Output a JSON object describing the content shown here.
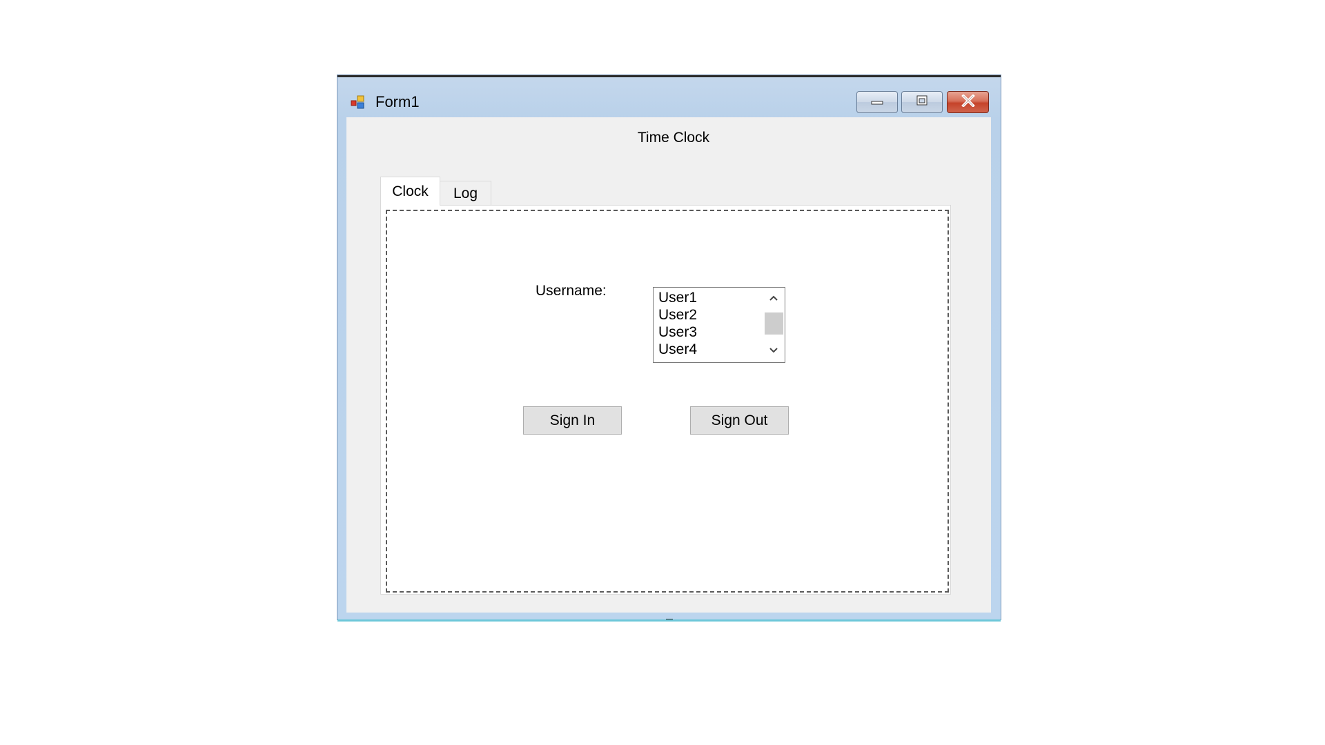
{
  "window": {
    "title": "Form1"
  },
  "title_controls": {
    "minimize_icon": "minimize-icon",
    "maximize_icon": "maximize-icon",
    "close_icon": "close-icon"
  },
  "form": {
    "header": "Time Clock"
  },
  "tabs": [
    {
      "label": "Clock",
      "selected": true
    },
    {
      "label": "Log",
      "selected": false
    }
  ],
  "clock_tab": {
    "username_label": "Username:",
    "users": [
      "User1",
      "User2",
      "User3",
      "User4"
    ],
    "sign_in_label": "Sign In",
    "sign_out_label": "Sign Out"
  },
  "colors": {
    "close_button": "#c5432a",
    "client_background": "#f0f0f0",
    "frame": "#b9d1ea"
  }
}
